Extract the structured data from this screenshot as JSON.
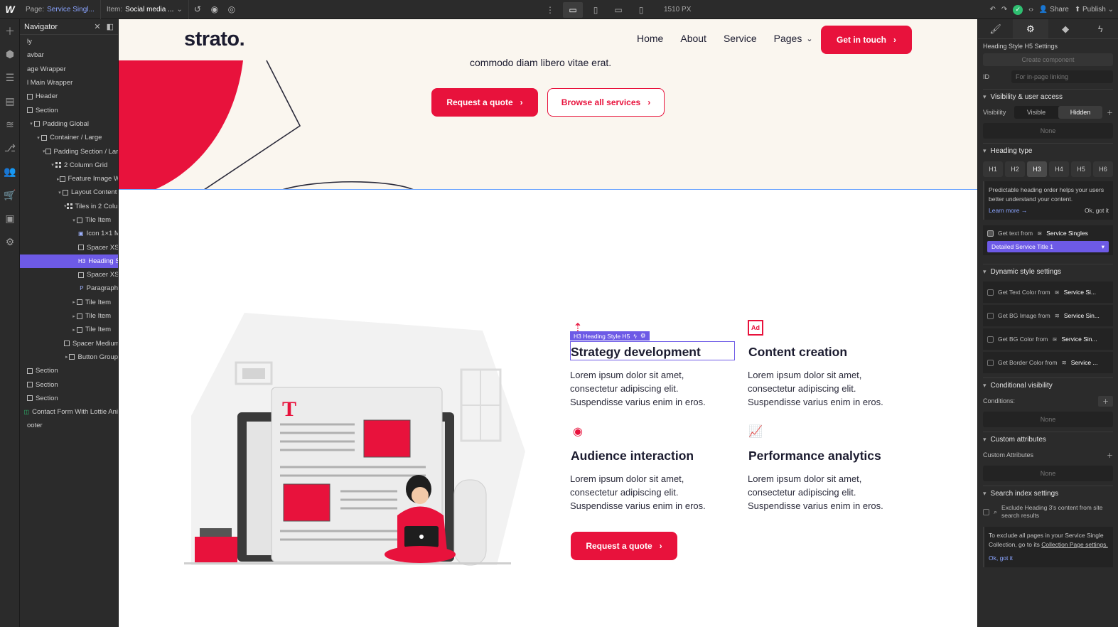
{
  "topbar": {
    "logo": "W",
    "page_label": "Page:",
    "page_value": "Service Singl...",
    "item_label": "Item:",
    "item_value": "Social media ...",
    "canvas_width": "1510 PX",
    "share": "Share",
    "publish": "Publish"
  },
  "navigator": {
    "title": "Navigator",
    "items": [
      {
        "label": "ly",
        "indent": 0,
        "kind": "none"
      },
      {
        "label": "avbar",
        "indent": 0,
        "kind": "none"
      },
      {
        "label": "age Wrapper",
        "indent": 0,
        "kind": "none"
      },
      {
        "label": "l Main Wrapper",
        "indent": 0,
        "kind": "none"
      },
      {
        "label": "Header",
        "indent": 0,
        "kind": "box"
      },
      {
        "label": "Section",
        "indent": 0,
        "kind": "box"
      },
      {
        "label": "Padding Global",
        "indent": 1,
        "kind": "box",
        "caret": "▾"
      },
      {
        "label": "Container / Large",
        "indent": 2,
        "kind": "box",
        "caret": "▾"
      },
      {
        "label": "Padding Section / Larg",
        "indent": 3,
        "kind": "box",
        "caret": "▾"
      },
      {
        "label": "2 Column Grid",
        "indent": 4,
        "kind": "grid",
        "caret": "▾"
      },
      {
        "label": "Feature Image Wr",
        "indent": 5,
        "kind": "box",
        "caret": "▸"
      },
      {
        "label": "Layout Content",
        "indent": 5,
        "kind": "box",
        "caret": "▾"
      },
      {
        "label": "Tiles in 2 Colum",
        "indent": 6,
        "kind": "grid",
        "caret": "▾"
      },
      {
        "label": "Tile Item",
        "indent": 7,
        "kind": "box",
        "caret": "▾"
      },
      {
        "label": "Icon 1×1 M",
        "indent": 8,
        "kind": "img"
      },
      {
        "label": "Spacer XSr",
        "indent": 8,
        "kind": "box"
      },
      {
        "label": "Heading St",
        "indent": 8,
        "kind": "h3",
        "selected": true
      },
      {
        "label": "Spacer XSr",
        "indent": 8,
        "kind": "box"
      },
      {
        "label": "Paragraph",
        "indent": 8,
        "kind": "p"
      },
      {
        "label": "Tile Item",
        "indent": 7,
        "kind": "box",
        "caret": "▸"
      },
      {
        "label": "Tile Item",
        "indent": 7,
        "kind": "box",
        "caret": "▸"
      },
      {
        "label": "Tile Item",
        "indent": 7,
        "kind": "box",
        "caret": "▸"
      },
      {
        "label": "Spacer Medium",
        "indent": 6,
        "kind": "box"
      },
      {
        "label": "Button Group",
        "indent": 6,
        "kind": "box",
        "caret": "▸"
      },
      {
        "label": "Section",
        "indent": 0,
        "kind": "box"
      },
      {
        "label": "Section",
        "indent": 0,
        "kind": "box"
      },
      {
        "label": "Section",
        "indent": 0,
        "kind": "box"
      },
      {
        "label": "Contact Form With Lottie Ani",
        "indent": 0,
        "kind": "green"
      },
      {
        "label": "ooter",
        "indent": 0,
        "kind": "none"
      }
    ]
  },
  "site": {
    "brand": "strato.",
    "menu": [
      "Home",
      "About",
      "Service",
      "Pages"
    ],
    "cta": "Get in touch",
    "hero_text": "commodo diam libero vitae erat.",
    "btn_quote": "Request a quote",
    "btn_browse": "Browse all services",
    "tiles": [
      {
        "icon": "target-arrows-icon",
        "title": "Strategy development",
        "body": "Lorem ipsum dolor sit amet, consectetur adipiscing elit. Suspendisse varius enim in eros."
      },
      {
        "icon": "ad-icon",
        "title": "Content creation",
        "body": "Lorem ipsum dolor sit amet, consectetur adipiscing elit. Suspendisse varius enim in eros."
      },
      {
        "icon": "target-icon",
        "title": "Audience interaction",
        "body": "Lorem ipsum dolor sit amet, consectetur adipiscing elit. Suspendisse varius enim in eros."
      },
      {
        "icon": "chart-line-icon",
        "title": "Performance analytics",
        "body": "Lorem ipsum dolor sit amet, consectetur adipiscing elit. Suspendisse varius enim in eros."
      }
    ],
    "btn_quote2": "Request a quote",
    "selection_tag": "H3 Heading Style H5",
    "accent": "#e8123c"
  },
  "settings": {
    "element_title": "Heading Style H5 Settings",
    "create_component": "Create component",
    "id_label": "ID",
    "id_placeholder": "For in-page linking",
    "visibility_section": "Visibility & user access",
    "visibility_label": "Visibility",
    "visible": "Visible",
    "hidden": "Hidden",
    "none": "None",
    "heading_type": "Heading type",
    "heading_levels": [
      "H1",
      "H2",
      "H3",
      "H4",
      "H5",
      "H6"
    ],
    "heading_note": "Predictable heading order helps your users better understand your content.",
    "learn_more": "Learn more →",
    "ok_got_it": "Ok, got it",
    "get_text_from": "Get text from",
    "service_singles": "Service Singles",
    "field_value": "Detailed Service Title 1",
    "dynamic_style": "Dynamic style settings",
    "dyn_rows": [
      {
        "label": "Get Text Color from",
        "src": "Service Si..."
      },
      {
        "label": "Get BG Image from",
        "src": "Service Sin..."
      },
      {
        "label": "Get BG Color from",
        "src": "Service Sin..."
      },
      {
        "label": "Get Border Color from",
        "src": "Service ..."
      }
    ],
    "conditional_visibility": "Conditional visibility",
    "conditions": "Conditions:",
    "custom_attributes": "Custom attributes",
    "custom_attributes_label": "Custom Attributes",
    "search_index": "Search index settings",
    "exclude_text": "Exclude Heading 3's content from site search results",
    "collection_note": "To exclude all pages in your Service Single Collection, go to its",
    "collection_link": "Collection Page settings.",
    "ok_got_it_2": "Ok, got it"
  }
}
